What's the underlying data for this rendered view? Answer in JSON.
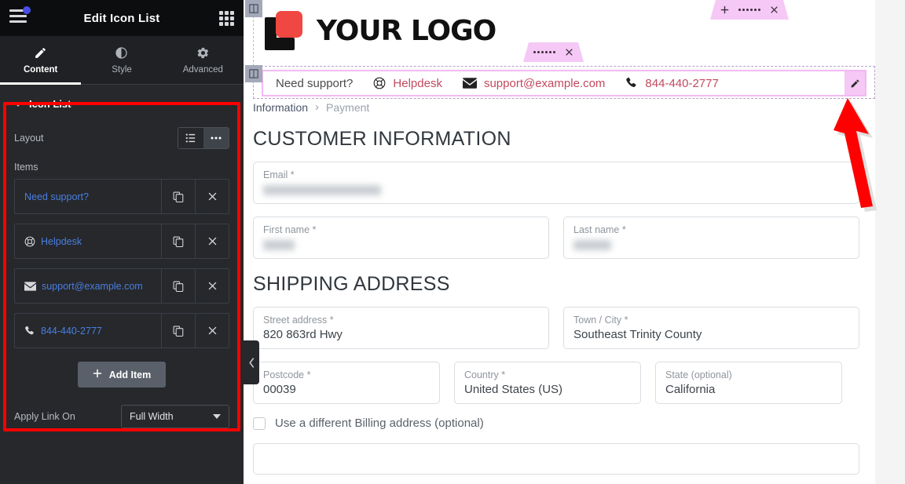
{
  "panel": {
    "title": "Edit Icon List",
    "menu_icon": "hamburger-icon",
    "apps_icon": "grid-apps-icon",
    "tabs": [
      {
        "label": "Content",
        "icon": "pencil-icon",
        "active": true
      },
      {
        "label": "Style",
        "icon": "contrast-circle-icon",
        "active": false
      },
      {
        "label": "Advanced",
        "icon": "gear-icon",
        "active": false
      }
    ],
    "section": {
      "title": "Icon List",
      "layout_label": "Layout",
      "layout_options": [
        "stacked",
        "inline"
      ],
      "layout_selected": "inline",
      "items_label": "Items",
      "items": [
        {
          "text": "Need support?",
          "icon": "none"
        },
        {
          "text": "Helpdesk",
          "icon": "life-ring-icon"
        },
        {
          "text": "support@example.com",
          "icon": "envelope-icon"
        },
        {
          "text": "844-440-2777",
          "icon": "phone-icon"
        }
      ],
      "item_duplicate_icon": "duplicate-icon",
      "item_remove_icon": "close-icon",
      "add_item_label": "Add Item"
    },
    "apply_link_on_label": "Apply Link On",
    "apply_link_on_value": "Full Width",
    "collapse_icon": "chevron-left-icon"
  },
  "canvas": {
    "logo": {
      "text": "YOUR LOGO",
      "mark_color": "#f04742"
    },
    "section_toolbar": {
      "add_icon": "plus-icon",
      "drag_icon": "drag-dots-icon",
      "close_icon": "close-icon"
    },
    "widget_toolbar": {
      "drag_icon": "drag-dots-icon",
      "close_icon": "close-icon"
    },
    "edit_icon": "pencil-icon",
    "icon_list": [
      {
        "text": "Need support?",
        "icon": "none",
        "link": false
      },
      {
        "text": "Helpdesk",
        "icon": "life-ring-icon",
        "link": true
      },
      {
        "text": "support@example.com",
        "icon": "envelope-icon",
        "link": true
      },
      {
        "text": "844-440-2777",
        "icon": "phone-icon",
        "link": true
      }
    ],
    "breadcrumb": {
      "current": "Information",
      "separator": "›",
      "next": "Payment"
    },
    "headings": {
      "customer": "CUSTOMER INFORMATION",
      "shipping": "SHIPPING ADDRESS"
    },
    "form": {
      "email": {
        "label": "Email *",
        "value": "",
        "redacted": true
      },
      "first_name": {
        "label": "First name *",
        "value": "",
        "redacted": true
      },
      "last_name": {
        "label": "Last name *",
        "value": "",
        "redacted": true
      },
      "street": {
        "label": "Street address *",
        "value": "820 863rd Hwy"
      },
      "city": {
        "label": "Town / City *",
        "value": "Southeast Trinity County"
      },
      "postcode": {
        "label": "Postcode *",
        "value": "00039"
      },
      "country": {
        "label": "Country *",
        "value": "United States (US)"
      },
      "state": {
        "label": "State (optional)",
        "value": "California"
      },
      "billing_checkbox": {
        "label": "Use a different Billing address (optional)",
        "checked": false
      }
    }
  },
  "annotation": {
    "arrow_color": "#ff0000",
    "points_to": "icon-list-widget"
  }
}
